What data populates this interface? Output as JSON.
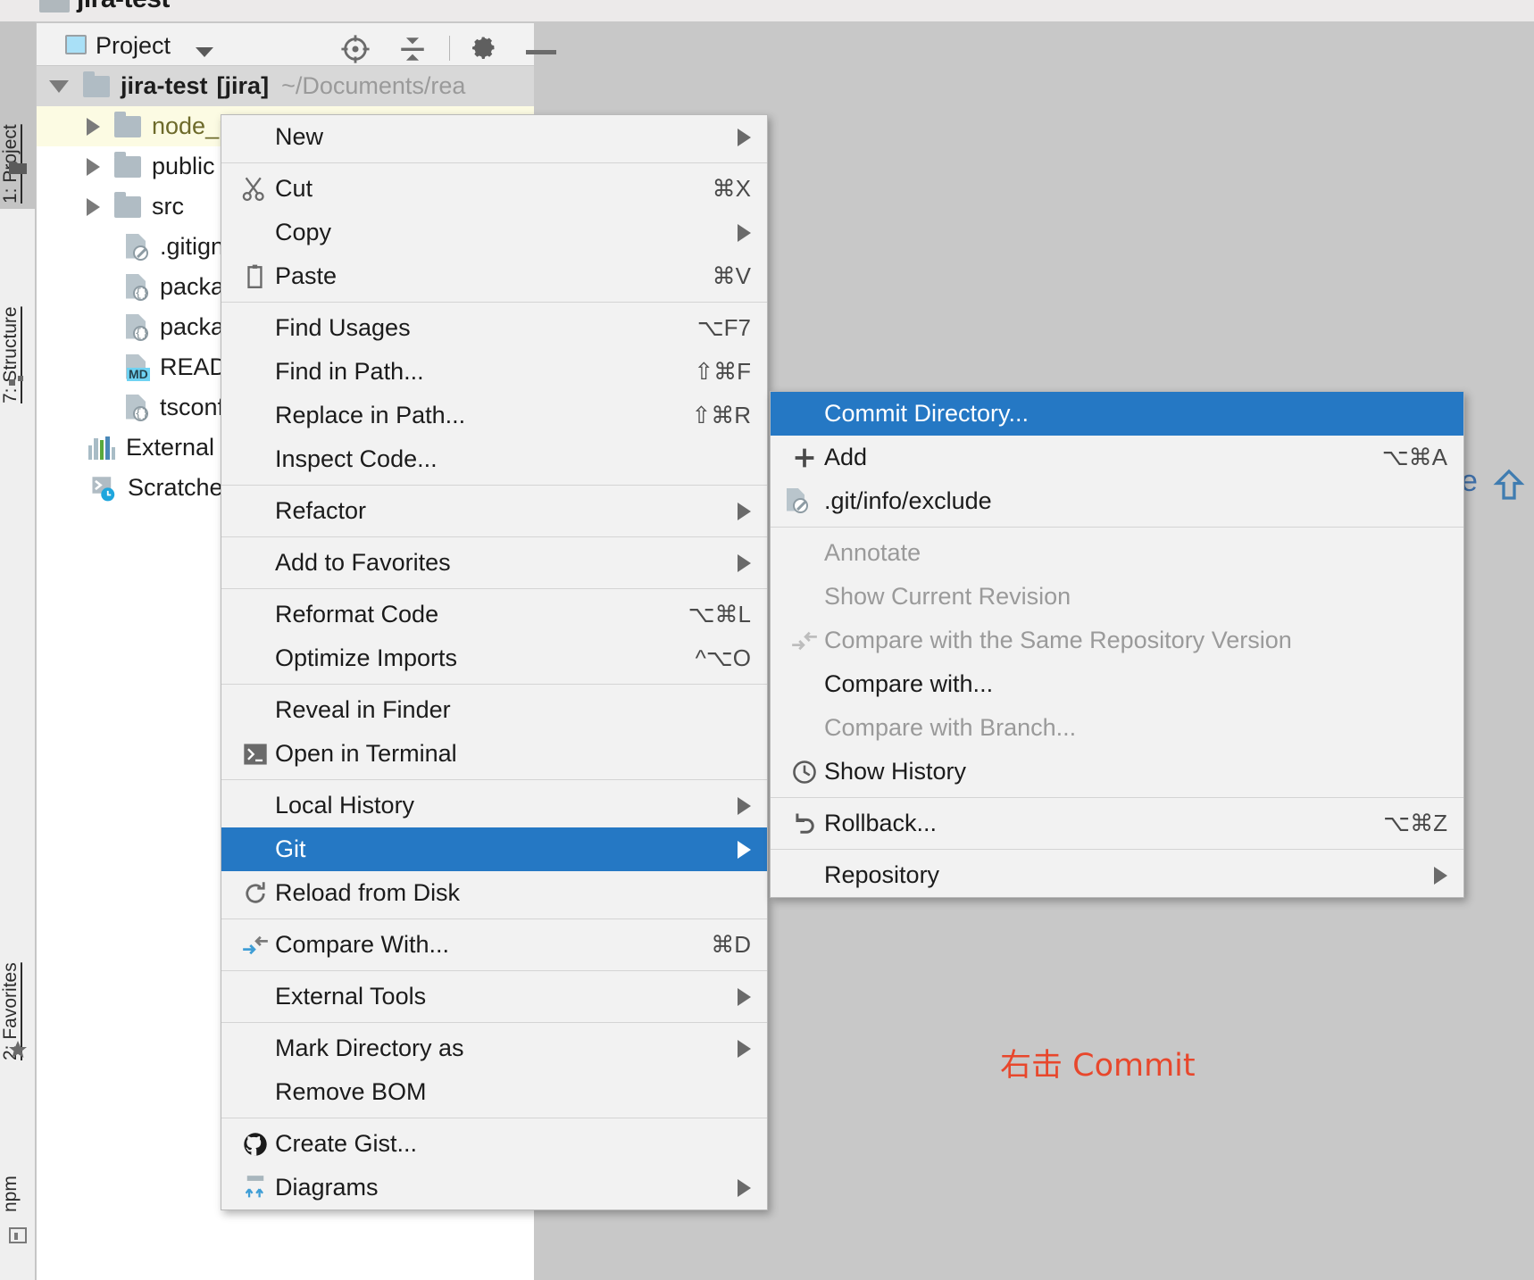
{
  "window": {
    "title": "jira-test",
    "icon": "folder-icon"
  },
  "left_tool_strip": {
    "tabs": [
      {
        "label": "1: Project",
        "selected": true,
        "icon": "folder-icon"
      },
      {
        "label": "7: Structure",
        "selected": false,
        "icon": "structure-icon"
      },
      {
        "label": "2: Favorites",
        "selected": false,
        "icon": "star-icon"
      },
      {
        "label": "npm",
        "selected": false,
        "icon": "npm-icon"
      }
    ]
  },
  "tool_window": {
    "title": "Project",
    "dropdown_caret": "chevron-down-icon",
    "buttons": [
      {
        "name": "locate-icon",
        "tooltip": "Select Opened File"
      },
      {
        "name": "collapse-all-icon",
        "tooltip": "Collapse All"
      },
      {
        "name": "gear-icon",
        "tooltip": "Settings"
      },
      {
        "name": "minimize-icon",
        "tooltip": "Hide"
      }
    ]
  },
  "project_tree": {
    "rows": [
      {
        "label": "jira-test",
        "bracket": "[jira]",
        "path": "~/Documents/rea",
        "icon": "folder-icon",
        "expanded": true,
        "depth": 0,
        "state": "root"
      },
      {
        "label": "node_modules",
        "icon": "folder-icon",
        "expanded": false,
        "depth": 1,
        "state": "highlighted"
      },
      {
        "label": "public",
        "icon": "folder-icon",
        "expanded": false,
        "depth": 1,
        "state": "normal"
      },
      {
        "label": "src",
        "icon": "folder-icon",
        "expanded": false,
        "depth": 1,
        "state": "normal"
      },
      {
        "label": ".gitignore",
        "icon": "file-ignored-icon",
        "depth": 2,
        "state": "normal"
      },
      {
        "label": "package-lock.json",
        "icon": "file-json-icon",
        "depth": 2,
        "state": "normal"
      },
      {
        "label": "package.json",
        "icon": "file-json-icon",
        "depth": 2,
        "state": "normal"
      },
      {
        "label": "README.md",
        "icon": "file-markdown-icon",
        "depth": 2,
        "state": "normal"
      },
      {
        "label": "tsconfig.json",
        "icon": "file-json-icon",
        "depth": 2,
        "state": "normal"
      },
      {
        "label": "External Libraries",
        "icon": "libraries-icon",
        "depth": 0,
        "state": "normal"
      },
      {
        "label": "Scratches and Consoles",
        "icon": "scratches-icon",
        "depth": 0,
        "state": "normal"
      }
    ]
  },
  "context_menu": {
    "items": [
      {
        "label": "New",
        "icon": null,
        "shortcut": "",
        "submenu": true,
        "state": "normal"
      },
      {
        "separator": true
      },
      {
        "label": "Cut",
        "icon": "scissors-icon",
        "shortcut": "⌘X",
        "submenu": false,
        "state": "normal"
      },
      {
        "label": "Copy",
        "icon": null,
        "shortcut": "",
        "submenu": true,
        "state": "normal"
      },
      {
        "label": "Paste",
        "icon": "clipboard-icon",
        "shortcut": "⌘V",
        "submenu": false,
        "state": "normal"
      },
      {
        "separator": true
      },
      {
        "label": "Find Usages",
        "icon": null,
        "shortcut": "⌥F7",
        "submenu": false,
        "state": "normal"
      },
      {
        "label": "Find in Path...",
        "icon": null,
        "shortcut": "⇧⌘F",
        "submenu": false,
        "state": "normal"
      },
      {
        "label": "Replace in Path...",
        "icon": null,
        "shortcut": "⇧⌘R",
        "submenu": false,
        "state": "normal"
      },
      {
        "label": "Inspect Code...",
        "icon": null,
        "shortcut": "",
        "submenu": false,
        "state": "normal"
      },
      {
        "separator": true
      },
      {
        "label": "Refactor",
        "icon": null,
        "shortcut": "",
        "submenu": true,
        "state": "normal"
      },
      {
        "separator": true
      },
      {
        "label": "Add to Favorites",
        "icon": null,
        "shortcut": "",
        "submenu": true,
        "state": "normal"
      },
      {
        "separator": true
      },
      {
        "label": "Reformat Code",
        "icon": null,
        "shortcut": "⌥⌘L",
        "submenu": false,
        "state": "normal"
      },
      {
        "label": "Optimize Imports",
        "icon": null,
        "shortcut": "^⌥O",
        "submenu": false,
        "state": "normal"
      },
      {
        "separator": true
      },
      {
        "label": "Reveal in Finder",
        "icon": null,
        "shortcut": "",
        "submenu": false,
        "state": "normal"
      },
      {
        "label": "Open in Terminal",
        "icon": "terminal-icon",
        "shortcut": "",
        "submenu": false,
        "state": "normal"
      },
      {
        "separator": true
      },
      {
        "label": "Local History",
        "icon": null,
        "shortcut": "",
        "submenu": true,
        "state": "normal"
      },
      {
        "label": "Git",
        "icon": null,
        "shortcut": "",
        "submenu": true,
        "state": "selected"
      },
      {
        "label": "Reload from Disk",
        "icon": "refresh-icon",
        "shortcut": "",
        "submenu": false,
        "state": "normal"
      },
      {
        "separator": true
      },
      {
        "label": "Compare With...",
        "icon": "compare-icon",
        "shortcut": "⌘D",
        "submenu": false,
        "state": "normal"
      },
      {
        "separator": true
      },
      {
        "label": "External Tools",
        "icon": null,
        "shortcut": "",
        "submenu": true,
        "state": "normal"
      },
      {
        "separator": true
      },
      {
        "label": "Mark Directory as",
        "icon": null,
        "shortcut": "",
        "submenu": true,
        "state": "normal"
      },
      {
        "label": "Remove BOM",
        "icon": null,
        "shortcut": "",
        "submenu": false,
        "state": "normal"
      },
      {
        "separator": true
      },
      {
        "label": "Create Gist...",
        "icon": "github-icon",
        "shortcut": "",
        "submenu": false,
        "state": "normal"
      },
      {
        "label": "Diagrams",
        "icon": "diagrams-icon",
        "shortcut": "",
        "submenu": true,
        "state": "normal"
      }
    ]
  },
  "git_submenu": {
    "items": [
      {
        "label": "Commit Directory...",
        "icon": null,
        "shortcut": "",
        "submenu": false,
        "state": "selected"
      },
      {
        "label": "Add",
        "icon": "plus-icon",
        "shortcut": "⌥⌘A",
        "submenu": false,
        "state": "normal"
      },
      {
        "label": ".git/info/exclude",
        "icon": "file-ignored-icon",
        "shortcut": "",
        "submenu": false,
        "state": "normal"
      },
      {
        "separator": true
      },
      {
        "label": "Annotate",
        "icon": null,
        "shortcut": "",
        "submenu": false,
        "state": "disabled"
      },
      {
        "label": "Show Current Revision",
        "icon": null,
        "shortcut": "",
        "submenu": false,
        "state": "disabled"
      },
      {
        "label": "Compare with the Same Repository Version",
        "icon": "compare-icon",
        "shortcut": "",
        "submenu": false,
        "state": "disabled"
      },
      {
        "label": "Compare with...",
        "icon": null,
        "shortcut": "",
        "submenu": false,
        "state": "normal"
      },
      {
        "label": "Compare with Branch...",
        "icon": null,
        "shortcut": "",
        "submenu": false,
        "state": "disabled"
      },
      {
        "label": "Show History",
        "icon": "clock-icon",
        "shortcut": "",
        "submenu": false,
        "state": "normal"
      },
      {
        "separator": true
      },
      {
        "label": "Rollback...",
        "icon": "undo-icon",
        "shortcut": "⌥⌘Z",
        "submenu": false,
        "state": "normal"
      },
      {
        "separator": true
      },
      {
        "label": "Repository",
        "icon": null,
        "shortcut": "",
        "submenu": true,
        "state": "normal"
      }
    ]
  },
  "annotation": {
    "text": "右击 Commit",
    "color": "#e8472c"
  },
  "edge_content": {
    "letter": "e",
    "arrow_icon": "arrow-up-icon"
  },
  "colors": {
    "selection_blue": "#2578c4",
    "menu_bg": "#f2f2f2",
    "tree_highlight": "#fcfbe3",
    "editor_bg": "#c8c8c8",
    "annotation_red": "#e8472c"
  }
}
